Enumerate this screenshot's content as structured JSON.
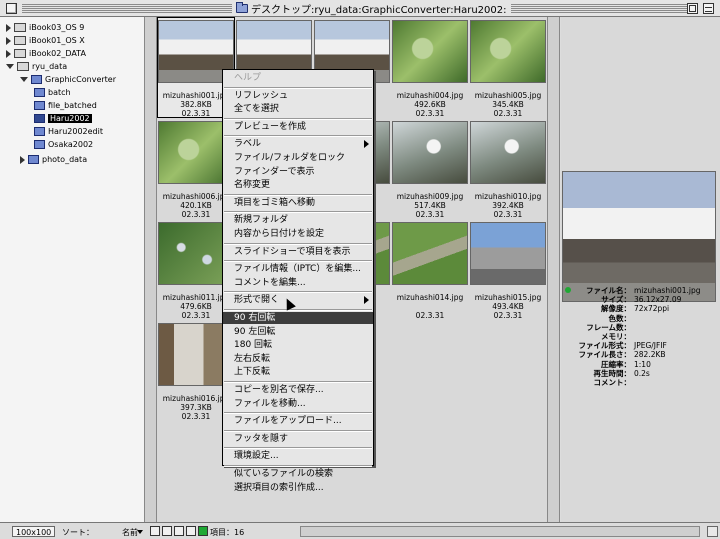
{
  "window": {
    "title": "デスクトップ:ryu_data:GraphicConverter:Haru2002:"
  },
  "tree": {
    "items": [
      {
        "label": "iBook03_OS 9",
        "type": "disk",
        "expanded": false
      },
      {
        "label": "iBook01_OS X",
        "type": "disk",
        "expanded": false
      },
      {
        "label": "iBook02_DATA",
        "type": "disk",
        "expanded": false
      },
      {
        "label": "ryu_data",
        "type": "disk",
        "expanded": true
      },
      {
        "label": "GraphicConverter",
        "type": "folder",
        "expanded": true
      },
      {
        "label": "batch",
        "type": "folder"
      },
      {
        "label": "file_batched",
        "type": "folder"
      },
      {
        "label": "Haru2002",
        "type": "folder",
        "selected": true
      },
      {
        "label": "Haru2002edit",
        "type": "folder"
      },
      {
        "label": "Osaka2002",
        "type": "folder"
      },
      {
        "label": "photo_data",
        "type": "folder",
        "expanded": false
      }
    ]
  },
  "files": [
    {
      "name": "mizuhashi001.jpg",
      "size": "382.8KB",
      "date": "02.3.31",
      "selected": true
    },
    {
      "name": "",
      "size": "",
      "date": ""
    },
    {
      "name": "",
      "size": "",
      "date": ""
    },
    {
      "name": "mizuhashi004.jpg",
      "size": "492.6KB",
      "date": "02.3.31"
    },
    {
      "name": "mizuhashi005.jpg",
      "size": "345.4KB",
      "date": "02.3.31"
    },
    {
      "name": "mizuhashi006.jpg",
      "size": "420.1KB",
      "date": "02.3.31"
    },
    {
      "name": "",
      "size": "",
      "date": ""
    },
    {
      "name": "",
      "size": "",
      "date": ""
    },
    {
      "name": "mizuhashi009.jpg",
      "size": "517.4KB",
      "date": "02.3.31"
    },
    {
      "name": "mizuhashi010.jpg",
      "size": "392.4KB",
      "date": "02.3.31"
    },
    {
      "name": "mizuhashi011.jpg",
      "size": "479.6KB",
      "date": "02.3.31"
    },
    {
      "name": "",
      "size": "",
      "date": ""
    },
    {
      "name": "",
      "size": "",
      "date": ""
    },
    {
      "name": "mizuhashi014.jpg",
      "size": "",
      "date": "02.3.31"
    },
    {
      "name": "mizuhashi015.jpg",
      "size": "493.4KB",
      "date": "02.3.31"
    },
    {
      "name": "mizuhashi016.jpg",
      "size": "397.3KB",
      "date": "02.3.31"
    }
  ],
  "context_menu": {
    "items": [
      {
        "label": "ヘルプ",
        "disabled": true
      },
      {
        "sep": true
      },
      {
        "label": "リフレッシュ"
      },
      {
        "label": "全てを選択"
      },
      {
        "sep": true
      },
      {
        "label": "プレビューを作成"
      },
      {
        "sep": true
      },
      {
        "label": "ラベル",
        "submenu": true
      },
      {
        "label": "ファイル/フォルダをロック"
      },
      {
        "label": "ファインダーで表示"
      },
      {
        "label": "名称変更"
      },
      {
        "sep": true
      },
      {
        "label": "項目をゴミ箱へ移動"
      },
      {
        "sep": true
      },
      {
        "label": "新規フォルダ"
      },
      {
        "label": "内容から日付けを設定"
      },
      {
        "sep": true
      },
      {
        "label": "スライドショーで項目を表示"
      },
      {
        "sep": true
      },
      {
        "label": "ファイル情報（IPTC）を編集..."
      },
      {
        "label": "コメントを編集..."
      },
      {
        "sep": true
      },
      {
        "label": "形式で開く",
        "submenu": true
      },
      {
        "sep": true
      },
      {
        "label": "90 右回転",
        "highlighted": true
      },
      {
        "label": "90 左回転"
      },
      {
        "label": "180 回転"
      },
      {
        "label": "左右反転"
      },
      {
        "label": "上下反転"
      },
      {
        "sep": true
      },
      {
        "label": "コピーを別名で保存..."
      },
      {
        "label": "ファイルを移動..."
      },
      {
        "sep": true
      },
      {
        "label": "ファイルをアップロード..."
      },
      {
        "sep": true
      },
      {
        "label": "フッタを隠す"
      },
      {
        "sep": true
      },
      {
        "label": "環境設定..."
      },
      {
        "sep": true
      },
      {
        "label": "似ているファイルの検索"
      },
      {
        "label": "選択項目の索引作成..."
      }
    ]
  },
  "info": {
    "rows": [
      {
        "key": "ファイル名：",
        "value": "mizuhashi001.jpg"
      },
      {
        "key": "サイズ：",
        "value": "36.12x27.09"
      },
      {
        "key": "解像度：",
        "value": "72x72ppi"
      },
      {
        "key": "色数：",
        "value": ""
      },
      {
        "key": "フレーム数：",
        "value": ""
      },
      {
        "key": "メモリ：",
        "value": ""
      },
      {
        "key": "ファイル形式：",
        "value": "JPEG/JFIF"
      },
      {
        "key": "ファイル長さ：",
        "value": "282.2KB"
      },
      {
        "key": "圧縮率：",
        "value": "1:10"
      },
      {
        "key": "再生時間：",
        "value": "0.2s"
      },
      {
        "key": "コメント：",
        "value": ""
      }
    ]
  },
  "bottombar": {
    "thumb_size": "100x100",
    "sort_label": "ソート：",
    "sort_value": "名前",
    "count": "項目：16"
  },
  "colors": {
    "selection": "#000000",
    "highlight": "#3d3d3d",
    "status_ok": "#1fa834"
  }
}
